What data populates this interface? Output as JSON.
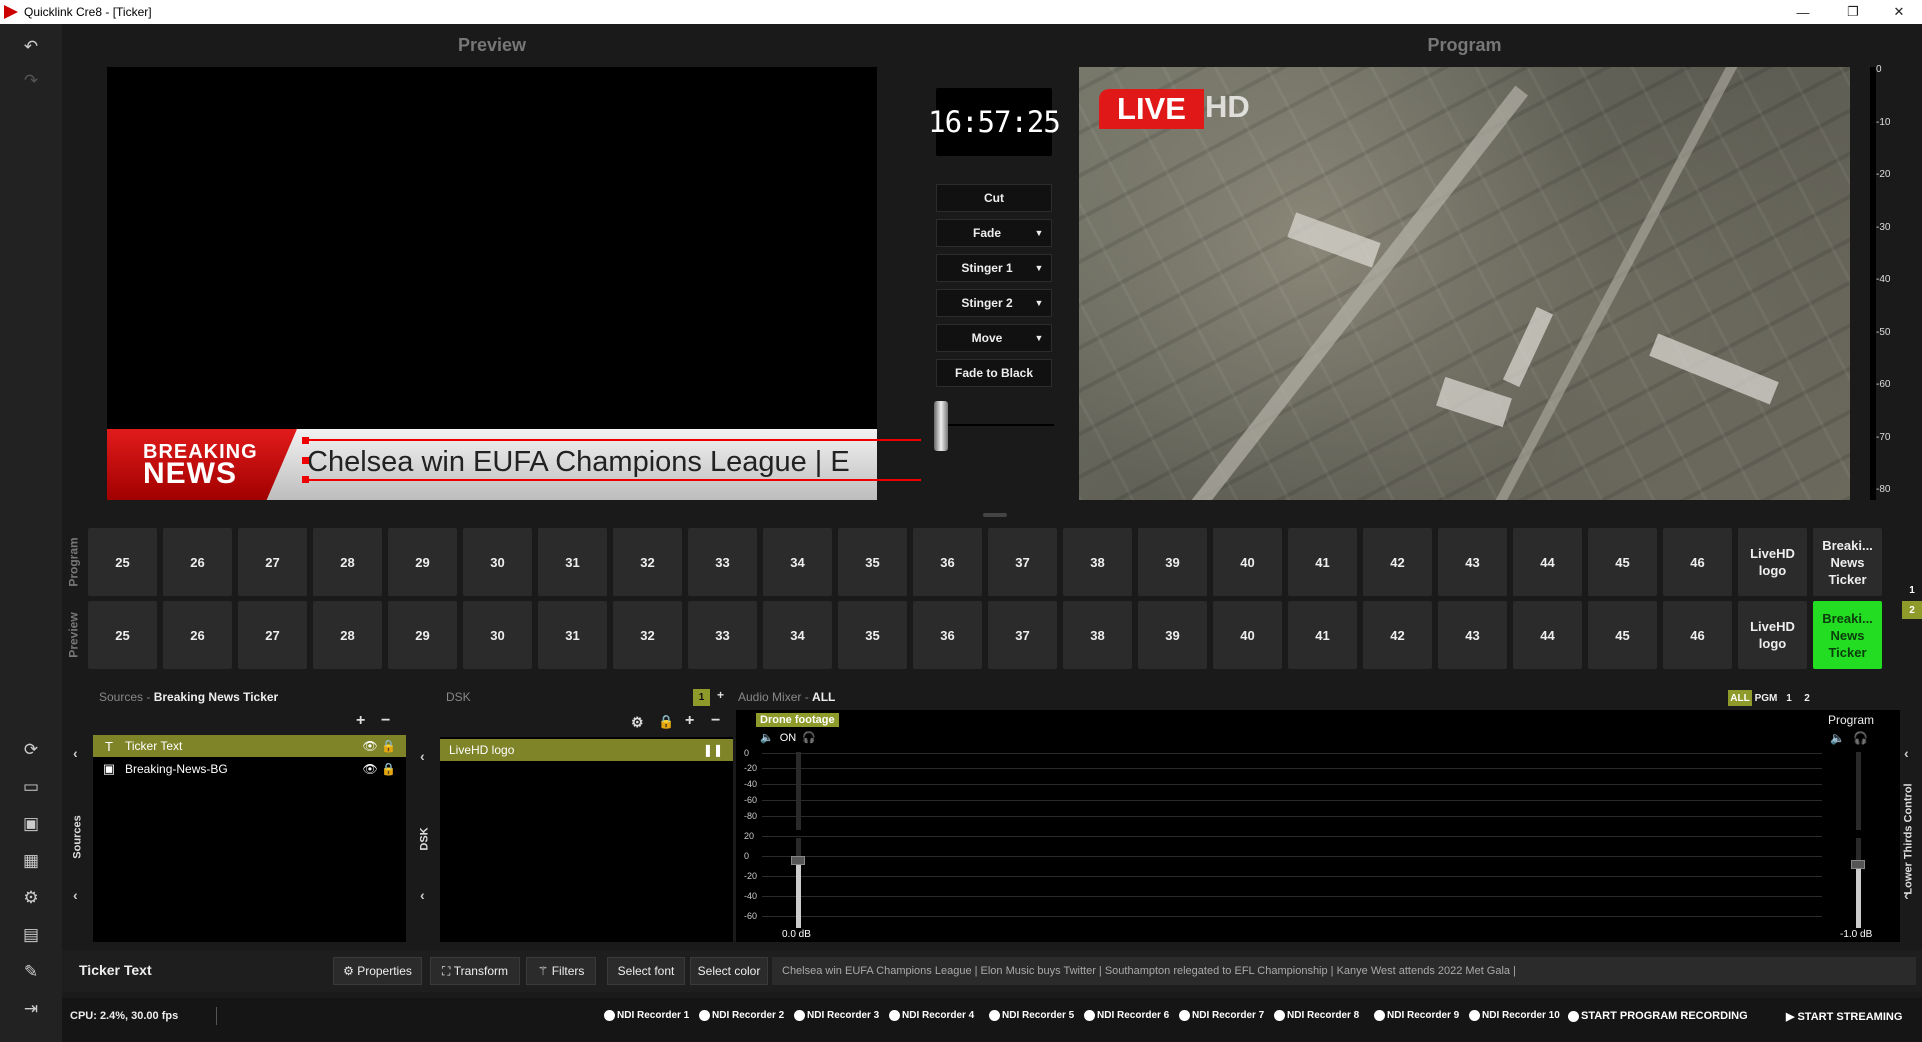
{
  "window": {
    "title": "Quicklink Cre8  - [Ticker]",
    "minimize": "—",
    "maximize": "❐",
    "close": "✕"
  },
  "preview": {
    "title": "Preview",
    "breaking_line1": "BREAKING",
    "breaking_line2": "NEWS",
    "ticker_text": "Chelsea win EUFA Champions League   |   E"
  },
  "program": {
    "title": "Program",
    "live_badge": "LIVE",
    "hd_badge": "HD"
  },
  "clock": "16:57:25",
  "transitions": [
    {
      "label": "Cut",
      "dropdown": false
    },
    {
      "label": "Fade",
      "dropdown": true
    },
    {
      "label": "Stinger 1",
      "dropdown": true
    },
    {
      "label": "Stinger 2",
      "dropdown": true
    },
    {
      "label": "Move",
      "dropdown": true
    },
    {
      "label": "Fade to Black",
      "dropdown": false
    }
  ],
  "meter_scale": [
    "0",
    "-10",
    "-20",
    "-30",
    "-40",
    "-50",
    "-60",
    "-70",
    "-80"
  ],
  "rows": {
    "program_label": "Program",
    "preview_label": "Preview",
    "program_buttons": [
      "25",
      "26",
      "27",
      "28",
      "29",
      "30",
      "31",
      "32",
      "33",
      "34",
      "35",
      "36",
      "37",
      "38",
      "39",
      "40",
      "41",
      "42",
      "43",
      "44",
      "45",
      "46",
      "LiveHD logo",
      "Breaki... News Ticker"
    ],
    "preview_buttons": [
      "25",
      "26",
      "27",
      "28",
      "29",
      "30",
      "31",
      "32",
      "33",
      "34",
      "35",
      "36",
      "37",
      "38",
      "39",
      "40",
      "41",
      "42",
      "43",
      "44",
      "45",
      "46",
      "LiveHD logo",
      "Breaki... News Ticker"
    ],
    "active_preview_index": 23,
    "page_tags": [
      "1",
      "2"
    ]
  },
  "sources": {
    "header_label": "Sources",
    "header_sep": "-",
    "header_value": "Breaking News Ticker",
    "side_tab": "Sources",
    "items": [
      {
        "label": "Ticker Text",
        "icon": "T"
      },
      {
        "label": "Breaking-News-BG",
        "icon": "▣"
      }
    ]
  },
  "dsk": {
    "header_label": "DSK",
    "side_tab": "DSK",
    "badge": "1",
    "items": [
      {
        "label": "LiveHD logo"
      }
    ]
  },
  "audio": {
    "header_label": "Audio Mixer",
    "header_sep": "-",
    "header_value": "ALL",
    "tabs": [
      "ALL",
      "PGM",
      "1",
      "2"
    ],
    "channel_name": "Drone footage",
    "on_label": "ON",
    "channel_db": "0.0 dB",
    "program_label": "Program",
    "program_db": "-1.0 dB",
    "scale_top": [
      "0",
      "-20",
      "-40",
      "-60",
      "-80"
    ],
    "scale_bottom": [
      "20",
      "0",
      "-20",
      "-40",
      "-60"
    ],
    "side_tab": "Lower Thirds Control"
  },
  "properties": {
    "selected": "Ticker Text",
    "buttons": [
      "Properties",
      "Transform",
      "Filters",
      "Select font",
      "Select color"
    ],
    "ticker_content": "Chelsea win EUFA Champions League   |   Elon Music buys Twitter   |   Southampton relegated to EFL Championship   |   Kanye West attends 2022 Met Gala   |"
  },
  "status": {
    "cpu": "CPU: 2.4%, 30.00 fps",
    "recorders": [
      "NDI Recorder 1",
      "NDI Recorder 2",
      "NDI Recorder 3",
      "NDI Recorder 4",
      "NDI Recorder 5",
      "NDI Recorder 6",
      "NDI Recorder 7",
      "NDI Recorder 8",
      "NDI Recorder 9",
      "NDI Recorder 10"
    ],
    "start_recording": "START PROGRAM RECORDING",
    "start_streaming": "START STREAMING"
  },
  "colors": {
    "accent_olive": "#7f8428",
    "active_green": "#22dd22",
    "live_red": "#e01818"
  }
}
